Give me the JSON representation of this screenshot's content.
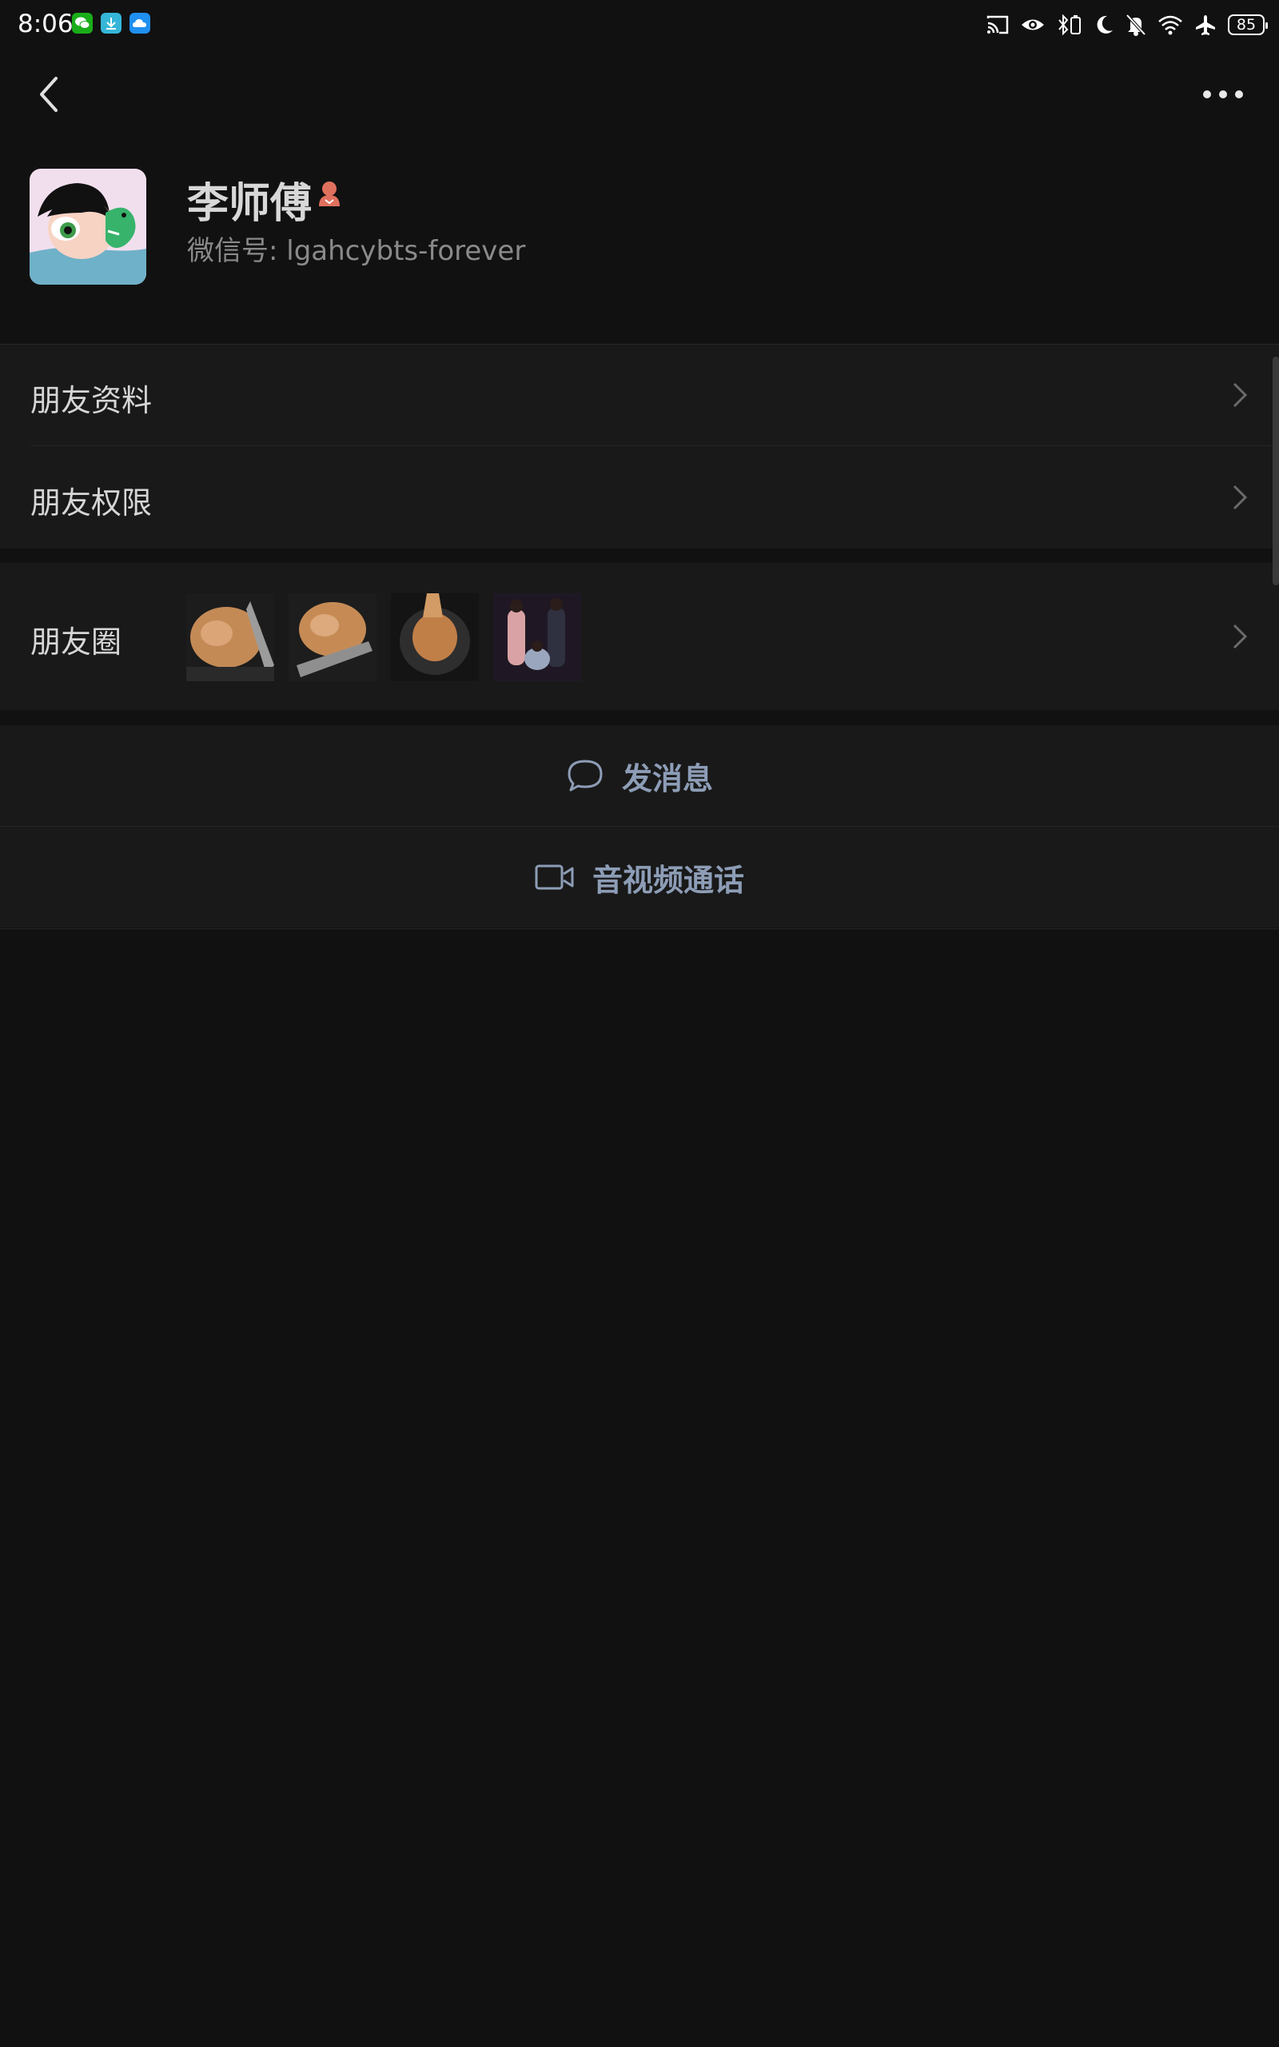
{
  "status_bar": {
    "time": "8:06",
    "app_badges": [
      "wechat-icon",
      "download-icon",
      "cloud-icon"
    ],
    "icons": [
      "cast-icon",
      "eye-icon",
      "bluetooth-battery-icon",
      "moon-icon",
      "bell-off-icon",
      "wifi-icon",
      "airplane-icon"
    ],
    "battery": "85"
  },
  "nav": {
    "back_icon": "back-arrow-icon",
    "more_icon": "more-icon"
  },
  "profile": {
    "name": "李师傅",
    "gender_icon": "female-icon",
    "wechat_id": "微信号: lgahcybts-forever"
  },
  "menu": {
    "friend_info": "朋友资料",
    "friend_permissions": "朋友权限",
    "moments": "朋友圈"
  },
  "actions": {
    "send_message": "发消息",
    "video_call": "音视频通话"
  },
  "colors": {
    "background": "#111111",
    "row_background": "#191919",
    "action_text": "#8d9db6",
    "gender_icon": "#e0705e",
    "wechat_green": "#1aad19"
  }
}
